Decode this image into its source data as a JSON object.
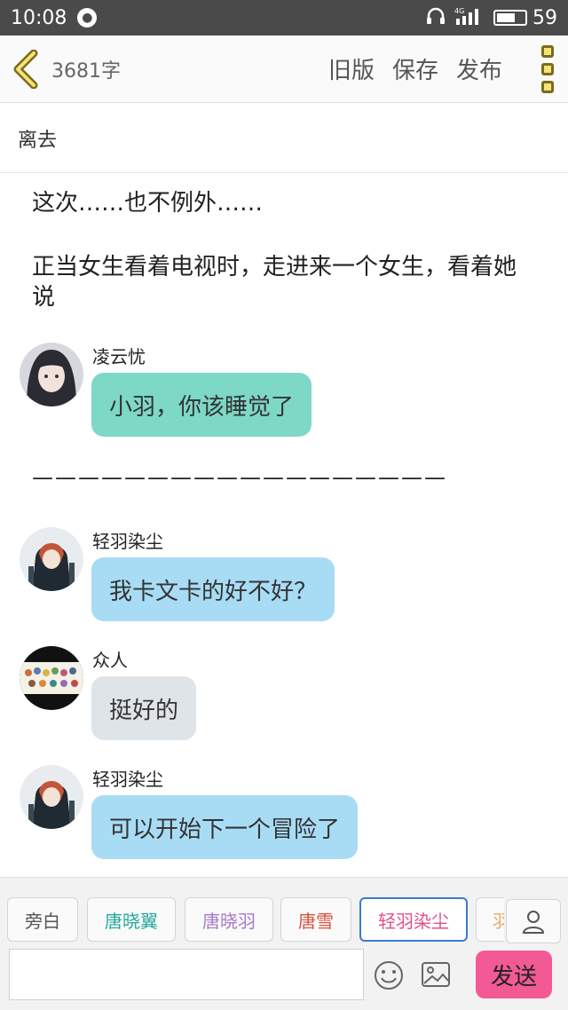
{
  "status_bar": {
    "time": "10:08",
    "network": "4G",
    "battery": "59"
  },
  "header": {
    "word_count": "3681字",
    "old_version": "旧版",
    "save": "保存",
    "publish": "发布"
  },
  "title": "离去",
  "content": {
    "narration_1": "这次……也不例外……",
    "narration_2": "正当女生看着电视时，走进来一个女生，看着她说",
    "divider": "——————————————————",
    "messages": [
      {
        "speaker": "凌云忧",
        "text": "小羽，你该睡觉了",
        "color": "#7dd8c6"
      },
      {
        "speaker": "轻羽染尘",
        "text": "我卡文卡的好不好？",
        "color": "#a8dcf5"
      },
      {
        "speaker": "众人",
        "text": "挺好的",
        "color": "#dfe4e8"
      },
      {
        "speaker": "轻羽染尘",
        "text": "可以开始下一个冒险了",
        "color": "#a8dcf5"
      }
    ]
  },
  "bottom": {
    "characters": [
      {
        "label": "旁白",
        "color": "#555555"
      },
      {
        "label": "唐晓翼",
        "color": "#22a89a"
      },
      {
        "label": "唐晓羽",
        "color": "#a67ac8"
      },
      {
        "label": "唐雪",
        "color": "#d8503c"
      },
      {
        "label": "轻羽染尘",
        "color": "#e0508a"
      },
      {
        "label": "羽",
        "color": "#e8a860"
      }
    ],
    "input_value": "",
    "send": "发送"
  }
}
